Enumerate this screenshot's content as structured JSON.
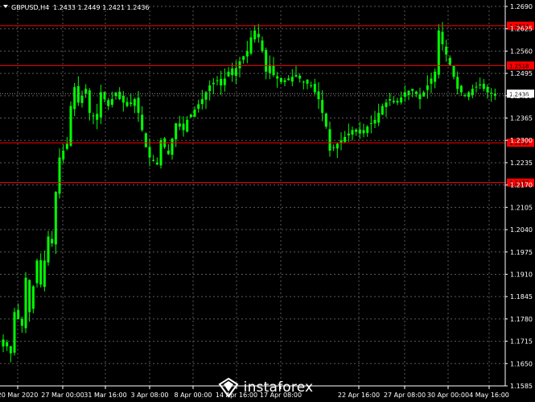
{
  "header": {
    "symbol": "GBPUSD,H4",
    "ohlc": "1.2433 1.2449 1.2421 1.2436"
  },
  "colors": {
    "background": "#000000",
    "grid": "#5a5a5a",
    "candle": "#00ff00",
    "level": "#ff0000",
    "axis_text": "#ffffff",
    "current_price_bg": "#ffffff"
  },
  "logo": {
    "text": "instaforex",
    "icon": "instaforex-logo-icon"
  },
  "chart_data": {
    "type": "candlestick",
    "y_ticks": [
      "1.2690",
      "1.2625",
      "1.2560",
      "1.2495",
      "1.2430",
      "1.2365",
      "1.2300",
      "1.2235",
      "1.2170",
      "1.2105",
      "1.2040",
      "1.1975",
      "1.1910",
      "1.1845",
      "1.1780",
      "1.1715",
      "1.1650",
      "1.1585"
    ],
    "ylim": [
      1.1585,
      1.269
    ],
    "x_ticks": [
      "20 Mar 2020",
      "27 Mar 00:00",
      "31 Mar 16:00",
      "3 Apr 08:00",
      "8 Apr 00:00",
      "14 Apr 16:00",
      "17 Apr 08:00",
      "22 Apr 16:00",
      "27 Apr 08:00",
      "30 Apr 00:00",
      "4 May 16:00"
    ],
    "levels": [
      {
        "price": 1.2634,
        "label": "1.2634"
      },
      {
        "price": 1.2518,
        "label": "1.2518"
      },
      {
        "price": 1.2293,
        "label": "1.2293"
      },
      {
        "price": 1.2177,
        "label": "1.2177"
      }
    ],
    "current_price": {
      "price": 1.2436,
      "label": "1.2436"
    },
    "close_path": [
      [
        0,
        1.172
      ],
      [
        2,
        1.168
      ],
      [
        3,
        1.18
      ],
      [
        5,
        1.176
      ],
      [
        6,
        1.19
      ],
      [
        7,
        1.18
      ],
      [
        9,
        1.195
      ],
      [
        10,
        1.188
      ],
      [
        12,
        1.202
      ],
      [
        13,
        1.2
      ],
      [
        14,
        1.215
      ],
      [
        15,
        1.225
      ],
      [
        17,
        1.229
      ],
      [
        18,
        1.24
      ],
      [
        19,
        1.2455
      ],
      [
        20,
        1.241
      ],
      [
        22,
        1.245
      ],
      [
        23,
        1.238
      ],
      [
        25,
        1.236
      ],
      [
        26,
        1.244
      ],
      [
        27,
        1.242
      ],
      [
        28,
        1.24
      ],
      [
        30,
        1.244
      ],
      [
        31,
        1.242
      ],
      [
        33,
        1.24
      ],
      [
        35,
        1.242
      ],
      [
        36,
        1.238
      ],
      [
        38,
        1.228
      ],
      [
        39,
        1.225
      ],
      [
        41,
        1.223
      ],
      [
        42,
        1.23
      ],
      [
        44,
        1.226
      ],
      [
        46,
        1.235
      ],
      [
        48,
        1.233
      ],
      [
        49,
        1.236
      ],
      [
        51,
        1.239
      ],
      [
        53,
        1.242
      ],
      [
        55,
        1.246
      ],
      [
        57,
        1.2475
      ],
      [
        58,
        1.246
      ],
      [
        60,
        1.25
      ],
      [
        61,
        1.249
      ],
      [
        63,
        1.253
      ],
      [
        65,
        1.256
      ],
      [
        66,
        1.26
      ],
      [
        67,
        1.262
      ],
      [
        68,
        1.26
      ],
      [
        69,
        1.256
      ],
      [
        70,
        1.25
      ],
      [
        71,
        1.252
      ],
      [
        72,
        1.249
      ],
      [
        74,
        1.247
      ],
      [
        76,
        1.248
      ],
      [
        78,
        1.249
      ],
      [
        80,
        1.247
      ],
      [
        82,
        1.246
      ],
      [
        84,
        1.242
      ],
      [
        86,
        1.234
      ],
      [
        87,
        1.227
      ],
      [
        89,
        1.229
      ],
      [
        91,
        1.231
      ],
      [
        93,
        1.233
      ],
      [
        95,
        1.232
      ],
      [
        97,
        1.234
      ],
      [
        99,
        1.236
      ],
      [
        101,
        1.24
      ],
      [
        103,
        1.242
      ],
      [
        105,
        1.241
      ],
      [
        107,
        1.244
      ],
      [
        109,
        1.245
      ],
      [
        111,
        1.242
      ],
      [
        113,
        1.246
      ],
      [
        115,
        1.25
      ],
      [
        116,
        1.262
      ],
      [
        117,
        1.258
      ],
      [
        119,
        1.252
      ],
      [
        121,
        1.245
      ],
      [
        123,
        1.243
      ],
      [
        125,
        1.245
      ],
      [
        127,
        1.246
      ],
      [
        129,
        1.244
      ],
      [
        131,
        1.2436
      ]
    ]
  }
}
